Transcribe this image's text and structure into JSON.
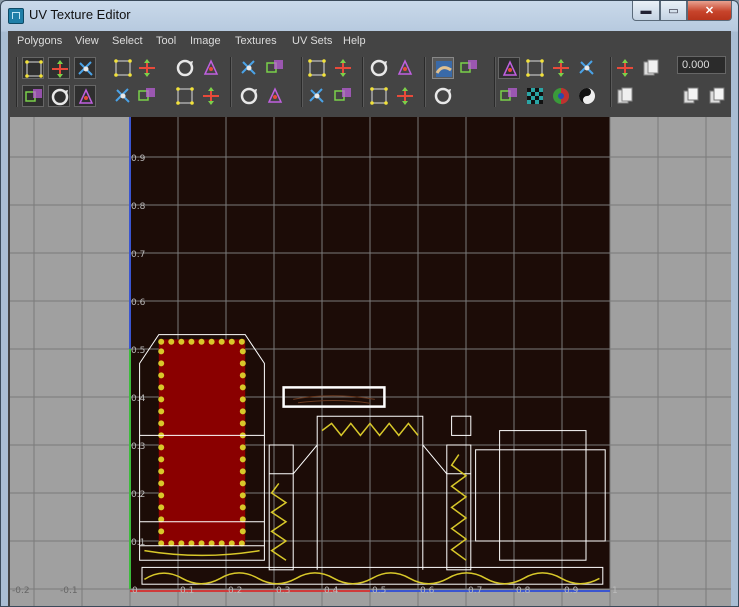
{
  "window": {
    "title": "UV Texture Editor",
    "min_glyph": "▬",
    "max_glyph": "▭",
    "close_glyph": "✕"
  },
  "menu": [
    "Polygons",
    "View",
    "Select",
    "Tool",
    "Image",
    "Textures",
    "UV Sets",
    "Help"
  ],
  "toolbar": {
    "value_field": "0.000",
    "buttons": [
      "select-uv-grid-icon",
      "move-uv-icon",
      "select-tool-icon",
      "translate-uv-icon",
      "flip-uv-icon",
      "cut-uv-icon",
      "sew-uv-icon",
      "layout-uv-icon",
      "align-uv-icon",
      "snap-uv-icon",
      "rotate-ccw-icon",
      "rotate-cw-icon",
      "straighten-uv-icon",
      "transfer-uv-icon",
      "unfold-uv-icon",
      "relax-uv-icon",
      "move-left-icon",
      "move-right-icon",
      "move-down-icon",
      "move-up-icon",
      "grid-uv-icon",
      "stack-uv-icon",
      "normalize-uv-icon",
      "map-uv-border-icon",
      "image-display-icon",
      "checker-toggle-icon",
      "dim-image-icon",
      "grid-display-icon",
      "magnet-snap-icon",
      "shell-copy-icon",
      "shell-paste-icon",
      "uv-border-icon",
      "checker-tiles-icon",
      "shaded-uv-icon",
      "display-toggle-icon",
      "texture-borders-icon",
      "distortion-icon",
      "refresh-icon",
      "copy-uv-icon",
      "paste-uv-icon"
    ]
  },
  "axes": {
    "u_labels": [
      "-0.2",
      "-0.1",
      "0",
      "0.1",
      "0.2",
      "0.3",
      "0.4",
      "0.5",
      "0.6",
      "0.7",
      "0.8",
      "0.9",
      "1"
    ],
    "v_labels": [
      "0.1",
      "0.2",
      "0.3",
      "0.4",
      "0.5",
      "0.6",
      "0.7",
      "0.8",
      "0.9"
    ]
  },
  "colors": {
    "uv_background": "#1c0c07",
    "grid_line": "#7a7a7a",
    "uv_wire": "#ffffff",
    "v_axis": "#3a55d0",
    "u_axis": "#d03a3a",
    "green_axis": "#3cbc3c",
    "texture_red": "#8a0000",
    "texture_yellow": "#d8c82a"
  }
}
